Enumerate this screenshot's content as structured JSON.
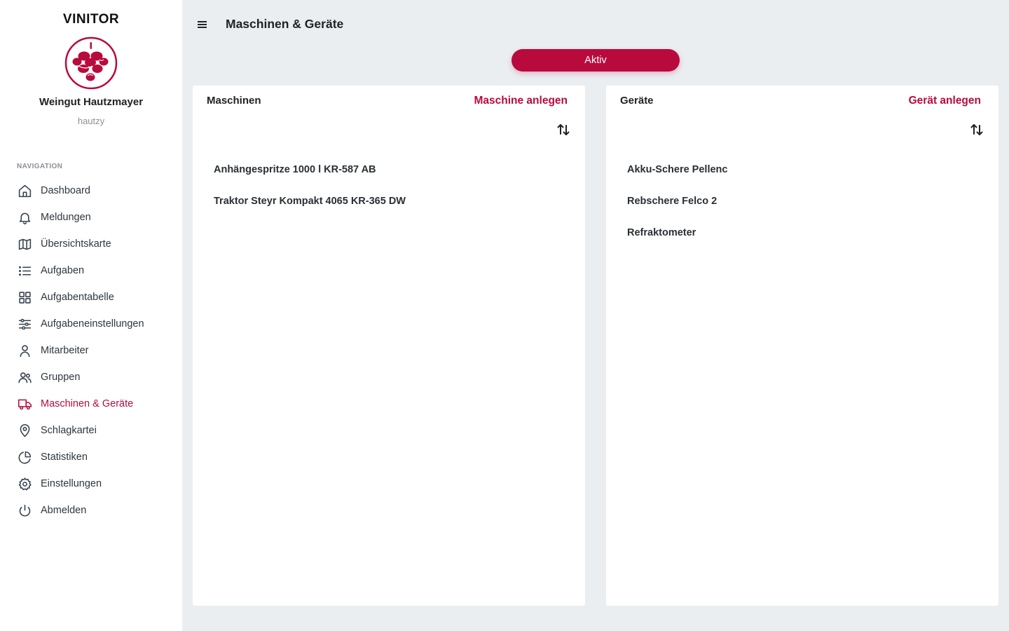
{
  "sidebar": {
    "brand": "VINITOR",
    "org_name": "Weingut Hautzmayer",
    "org_handle": "hautzy",
    "nav_heading": "NAVIGATION",
    "items": [
      {
        "label": "Dashboard",
        "icon": "home-icon"
      },
      {
        "label": "Meldungen",
        "icon": "bell-icon"
      },
      {
        "label": "Übersichtskarte",
        "icon": "map-icon"
      },
      {
        "label": "Aufgaben",
        "icon": "list-icon"
      },
      {
        "label": "Aufgabentabelle",
        "icon": "grid-icon"
      },
      {
        "label": "Aufgabeneinstellungen",
        "icon": "sliders-icon"
      },
      {
        "label": "Mitarbeiter",
        "icon": "user-icon"
      },
      {
        "label": "Gruppen",
        "icon": "users-icon"
      },
      {
        "label": "Maschinen & Geräte",
        "icon": "truck-icon",
        "active": true
      },
      {
        "label": "Schlagkartei",
        "icon": "map-pin-icon"
      },
      {
        "label": "Statistiken",
        "icon": "pie-chart-icon"
      },
      {
        "label": "Einstellungen",
        "icon": "gear-icon"
      },
      {
        "label": "Abmelden",
        "icon": "power-icon"
      }
    ]
  },
  "header": {
    "title": "Maschinen & Geräte"
  },
  "status_filter": {
    "label": "Aktiv"
  },
  "machines": {
    "title": "Maschinen",
    "action": "Maschine anlegen",
    "items": [
      "Anhängespritze 1000 l KR-587 AB",
      "Traktor Steyr Kompakt 4065 KR-365 DW"
    ]
  },
  "devices": {
    "title": "Geräte",
    "action": "Gerät anlegen",
    "items": [
      "Akku-Schere Pellenc",
      "Rebschere Felco 2",
      "Refraktometer"
    ]
  },
  "colors": {
    "accent": "#b80a3d",
    "background": "#ebeef1",
    "surface": "#ffffff"
  }
}
